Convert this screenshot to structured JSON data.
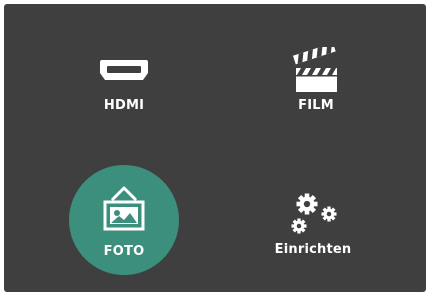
{
  "menu": {
    "items": [
      {
        "label": "HDMI",
        "icon": "hdmi-icon"
      },
      {
        "label": "FILM",
        "icon": "clapperboard-icon"
      },
      {
        "label": "FOTO",
        "icon": "photo-icon",
        "selected": true
      },
      {
        "label": "Einrichten",
        "icon": "gears-icon"
      }
    ]
  },
  "colors": {
    "background": "#3f3f3f",
    "selected_highlight": "#3c8f7d",
    "foreground": "#ffffff"
  }
}
